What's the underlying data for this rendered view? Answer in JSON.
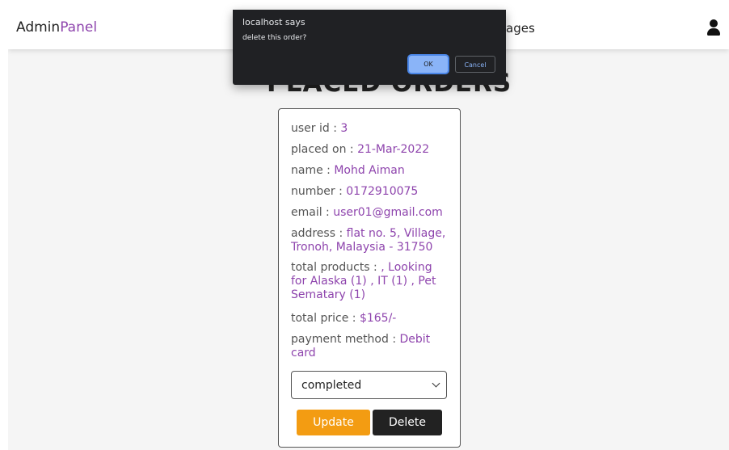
{
  "header": {
    "logo_main": "Admin",
    "logo_accent": "Panel",
    "nav_partial": "ages"
  },
  "main": {
    "title": "PLACED ORDERS"
  },
  "order": {
    "user_id": {
      "label": "user id : ",
      "value": "3"
    },
    "placed_on": {
      "label": "placed on : ",
      "value": "21-Mar-2022"
    },
    "name": {
      "label": "name : ",
      "value": "Mohd Aiman"
    },
    "number": {
      "label": "number : ",
      "value": "0172910075"
    },
    "email": {
      "label": "email : ",
      "value": "user01@gmail.com"
    },
    "address": {
      "label": "address : ",
      "value": "flat no. 5, Village, Tronoh, Malaysia - 31750"
    },
    "total_products": {
      "label": "total products : ",
      "value": ", Looking for Alaska (1) , IT (1) , Pet Sematary (1)"
    },
    "total_price": {
      "label": "total price : ",
      "value": "$165/-"
    },
    "payment_method": {
      "label": "payment method : ",
      "value": "Debit card"
    },
    "status": "completed",
    "update_label": "Update",
    "delete_label": "Delete"
  },
  "dialog": {
    "title": "localhost says",
    "message": "delete this order?",
    "ok_label": "OK",
    "cancel_label": "Cancel"
  },
  "colors": {
    "accent": "#8e44ad",
    "update_button": "#f39c12",
    "delete_button": "#222222",
    "dialog_bg": "#202124",
    "dialog_primary": "#8ab4f8"
  },
  "icons": {
    "user": "user-icon"
  }
}
